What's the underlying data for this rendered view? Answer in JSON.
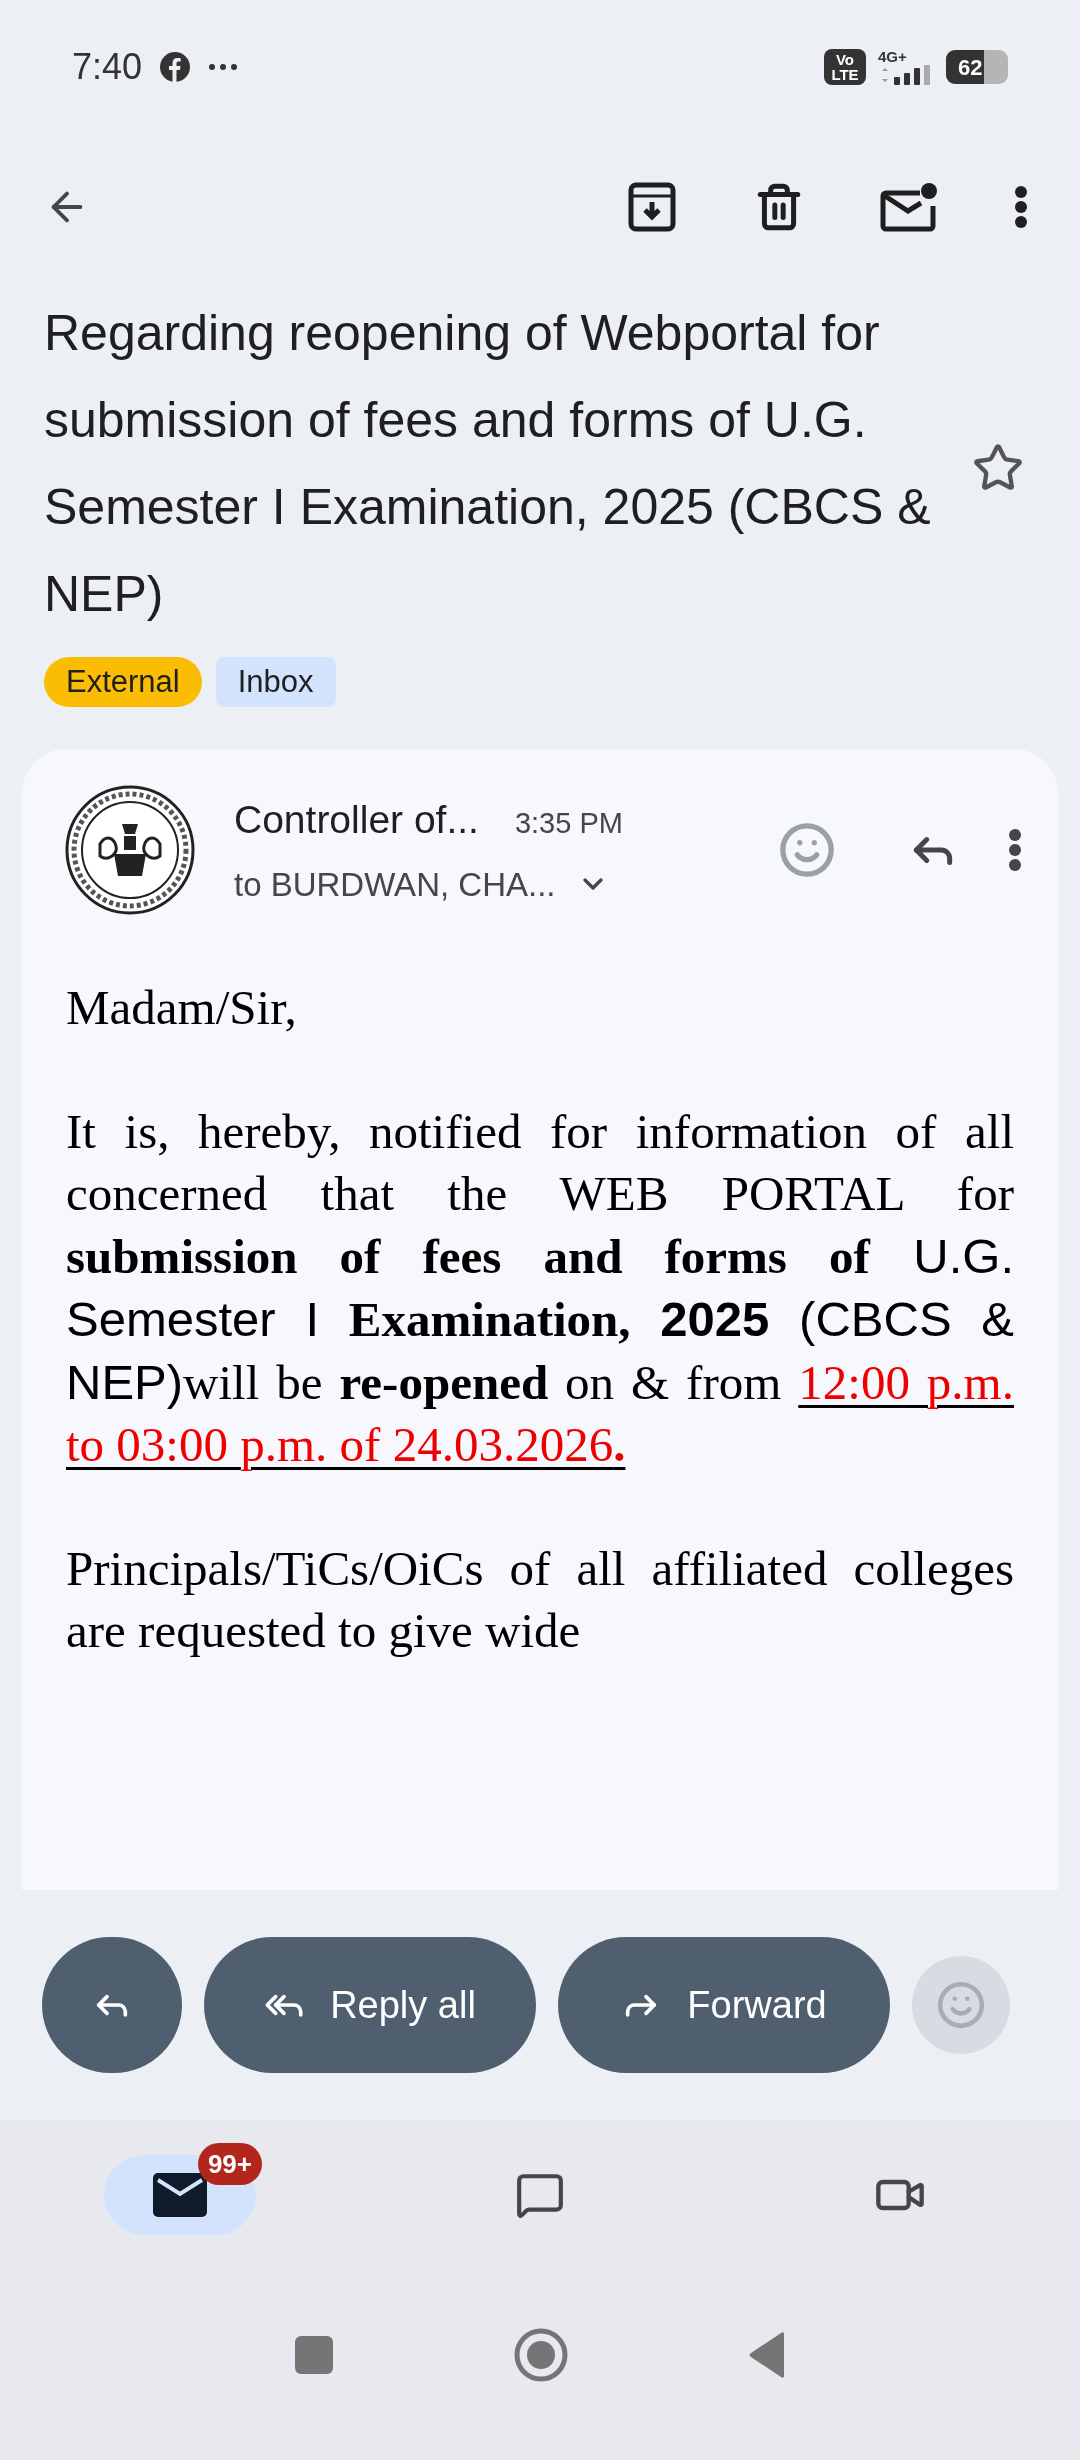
{
  "status_bar": {
    "time": "7:40",
    "volte_top": "Vo",
    "volte_bottom": "LTE",
    "network": "4G+",
    "battery": "62"
  },
  "subject": "Regarding reopening of Webportal for submission of fees and forms of U.G. Semester I Examination, 2025 (CBCS & NEP)",
  "starred": false,
  "labels": [
    {
      "text": "External",
      "color": "#fbbc04"
    },
    {
      "text": "Inbox",
      "color": "#d3e3fd"
    }
  ],
  "message": {
    "sender": "Controller of...",
    "time": "3:35 PM",
    "recipients": "to BURDWAN, CHA...",
    "greeting": "Madam/Sir,",
    "paragraphs": [
      [
        {
          "text": "It is, hereby, notified for information of all concerned that the WEB PORTAL for "
        },
        {
          "text": "submission of fees and forms of",
          "bold": true
        },
        {
          "text": " U.G. Semester I ",
          "sans": true
        },
        {
          "text": "Examination,",
          "bold": true
        },
        {
          "text": " 2025",
          "bold": true,
          "sans": true
        },
        {
          "text": " (CBCS & NEP)",
          "sans": true
        },
        {
          "text": "will be "
        },
        {
          "text": "re-opened",
          "bold": true
        },
        {
          "text": " on & from "
        },
        {
          "text": "12:00 p.m. to 03:00 p.m. of 24.03.2026",
          "highlight": true
        },
        {
          "text": ".",
          "highlight": true,
          "bold": true
        }
      ],
      [
        {
          "text": "Principals/TiCs/OiCs of all affiliated colleges are requested to give wide"
        }
      ]
    ]
  },
  "actions": [
    {
      "kind": "reply"
    },
    {
      "kind": "reply_all",
      "label": "Reply all"
    },
    {
      "kind": "forward",
      "label": "Forward"
    }
  ],
  "bottom_nav": [
    {
      "kind": "mail",
      "selected": true,
      "badge": "99+"
    },
    {
      "kind": "chat",
      "selected": false
    },
    {
      "kind": "video",
      "selected": false
    }
  ]
}
